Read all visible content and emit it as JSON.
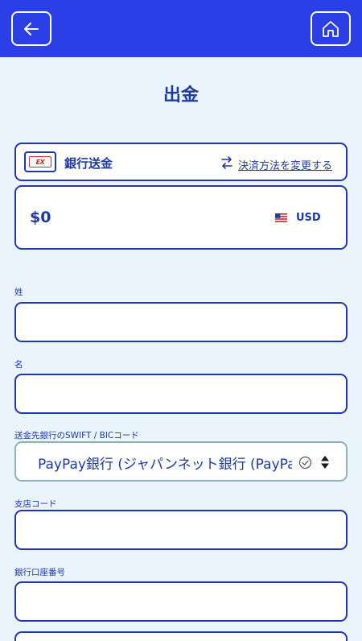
{
  "page": {
    "title": "出金"
  },
  "payment_method": {
    "name": "銀行送金",
    "logo_text": "EX",
    "change_label": "決済方法を変更する"
  },
  "amount": {
    "value": "$0",
    "currency": "USD"
  },
  "fields": {
    "last_name_label": "姓",
    "first_name_label": "名",
    "swift_label": "送金先銀行のSWIFT / BICコード",
    "swift_value": "PayPay銀行 (ジャパンネット銀行 (PayPay",
    "branch_label": "支店コード",
    "account_label": "銀行口座番号"
  },
  "colors": {
    "header_bg": "#2b3fe6",
    "page_bg": "#eaf4fd",
    "primary": "#1e3aa0",
    "border": "#2236b0"
  }
}
